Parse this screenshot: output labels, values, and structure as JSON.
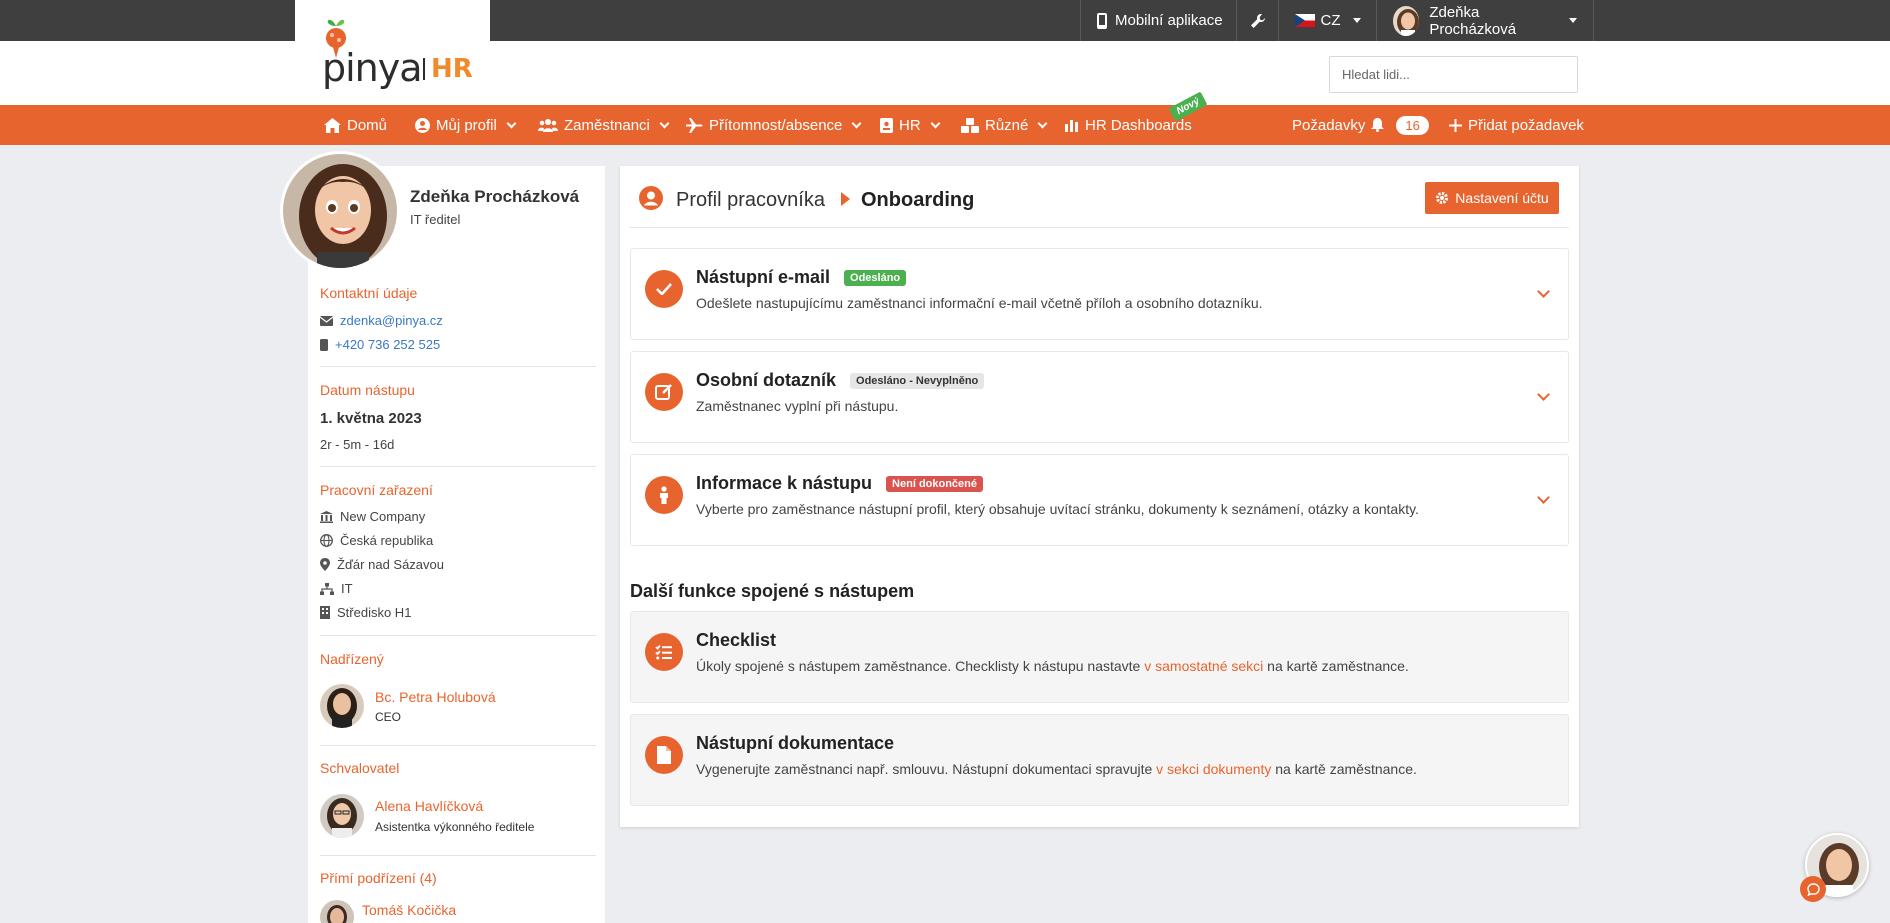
{
  "brand": {
    "logo_text": "pinya",
    "logo_suffix": "HR"
  },
  "topbar": {
    "mobile_app": "Mobilní aplikace",
    "language": "CZ",
    "user_name": "Zdeňka Procházková"
  },
  "search": {
    "placeholder": "Hledat lidi..."
  },
  "nav": {
    "items": [
      {
        "label": "Domů"
      },
      {
        "label": "Můj profil"
      },
      {
        "label": "Zaměstnanci"
      },
      {
        "label": "Přítomnost/absence"
      },
      {
        "label": "HR"
      },
      {
        "label": "Různé"
      },
      {
        "label": "HR Dashboards"
      }
    ],
    "new_badge": "Nový",
    "requests_label": "Požadavky",
    "requests_count": "16",
    "add_request": "Přidat požadavek"
  },
  "profile": {
    "name": "Zdeňka Procházková",
    "title": "IT ředitel",
    "contact_heading": "Kontaktní údaje",
    "email": "zdenka@pinya.cz",
    "phone": "+420 736 252 525",
    "start_heading": "Datum nástupu",
    "start_date": "1. května 2023",
    "tenure": "2r - 5m - 16d",
    "position_heading": "Pracovní zařazení",
    "company": "New Company",
    "country": "Česká republika",
    "city": "Žďár nad Sázavou",
    "department": "IT",
    "cost_center": "Středisko H1",
    "manager_heading": "Nadřízený",
    "manager_name": "Bc. Petra Holubová",
    "manager_role": "CEO",
    "approver_heading": "Schvalovatel",
    "approver_name": "Alena Havlíčková",
    "approver_role": "Asistentka výkonného ředitele",
    "reports_heading": "Přímí podřízení (4)",
    "report1_name": "Tomáš Kočička"
  },
  "main": {
    "breadcrumb_parent": "Profil pracovníka",
    "breadcrumb_current": "Onboarding",
    "settings_button": "Nastavení účtu",
    "cards": [
      {
        "title": "Nástupní e-mail",
        "badge": "Odesláno",
        "badge_color": "#4caf50",
        "desc": "Odešlete nastupujícímu zaměstnanci informační e-mail včetně příloh a osobního dotazníku."
      },
      {
        "title": "Osobní dotazník",
        "badge": "Odesláno - Nevyplněno",
        "badge_color": "#e6e6e6",
        "desc": "Zaměstnanec vyplní při nástupu."
      },
      {
        "title": "Informace k nástupu",
        "badge": "Není dokončené",
        "badge_color": "#d9534f",
        "desc": "Vyberte pro zaměstnance nástupní profil, který obsahuje uvítací stránku, dokumenty k seznámení, otázky a kontakty."
      }
    ],
    "section_heading": "Další funkce spojené s nástupem",
    "extra": [
      {
        "title": "Checklist",
        "desc_before": "Úkoly spojené s nástupem zaměstnance. Checklisty k nástupu nastavte ",
        "link": "v samostatné sekci",
        "desc_after": " na kartě zaměstnance."
      },
      {
        "title": "Nástupní dokumentace",
        "desc_before": "Vygenerujte zaměstnanci např. smlouvu. Nástupní dokumentaci spravujte ",
        "link": "v sekci dokumenty",
        "desc_after": " na kartě zaměstnance."
      }
    ]
  },
  "colors": {
    "accent": "#e8642f",
    "topbar": "#3f3f3f",
    "link": "#3a78c3",
    "background": "#ebedf0"
  }
}
